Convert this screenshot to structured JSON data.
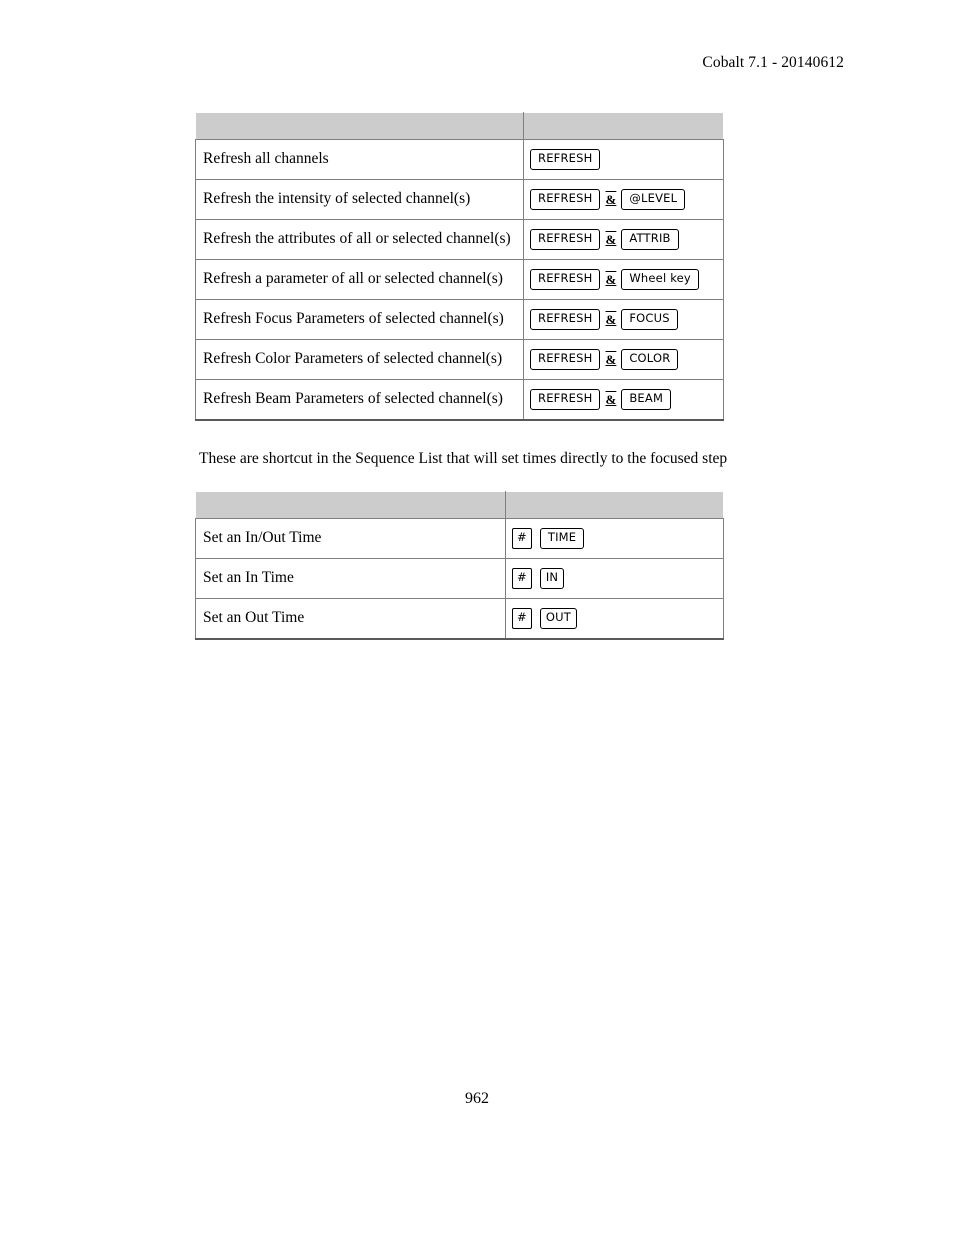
{
  "document": {
    "header": "Cobalt 7.1 - 20140612",
    "page_number": "962"
  },
  "refresh_table": {
    "header": {
      "col1": "",
      "col2": ""
    },
    "rows": [
      {
        "description": "Refresh all channels",
        "keys": [
          {
            "type": "key",
            "label": "REFRESH"
          }
        ]
      },
      {
        "description": "Refresh the intensity of selected channel(s)",
        "keys": [
          {
            "type": "key",
            "label": "REFRESH"
          },
          {
            "type": "sep",
            "label": "&"
          },
          {
            "type": "key",
            "label": "@LEVEL"
          }
        ]
      },
      {
        "description": "Refresh the attributes of all or selected channel(s)",
        "keys": [
          {
            "type": "key",
            "label": "REFRESH"
          },
          {
            "type": "sep",
            "label": "&"
          },
          {
            "type": "key",
            "label": "ATTRIB"
          }
        ]
      },
      {
        "description": "Refresh a parameter of all or selected channel(s)",
        "keys": [
          {
            "type": "key",
            "label": "REFRESH"
          },
          {
            "type": "sep",
            "label": "&"
          },
          {
            "type": "key",
            "label": "Wheel key"
          }
        ]
      },
      {
        "description": "Refresh Focus Parameters of selected channel(s)",
        "keys": [
          {
            "type": "key",
            "label": "REFRESH"
          },
          {
            "type": "sep",
            "label": "&"
          },
          {
            "type": "key",
            "label": "FOCUS"
          }
        ]
      },
      {
        "description": "Refresh Color Parameters of selected channel(s)",
        "keys": [
          {
            "type": "key",
            "label": "REFRESH"
          },
          {
            "type": "sep",
            "label": "&"
          },
          {
            "type": "key",
            "label": "COLOR"
          }
        ]
      },
      {
        "description": "Refresh Beam Parameters of selected channel(s)",
        "keys": [
          {
            "type": "key",
            "label": "REFRESH"
          },
          {
            "type": "sep",
            "label": "&"
          },
          {
            "type": "key",
            "label": "BEAM"
          }
        ]
      }
    ]
  },
  "sequence_note": "These are shortcut in the Sequence List that will set times directly to the focused step",
  "times_table": {
    "header": {
      "col1": "",
      "col2": ""
    },
    "rows": [
      {
        "description": "Set an In/Out Time",
        "keys": [
          {
            "type": "hash",
            "label": "#"
          },
          {
            "type": "key",
            "label": "TIME"
          }
        ]
      },
      {
        "description": "Set an In Time",
        "keys": [
          {
            "type": "hash",
            "label": "#"
          },
          {
            "type": "key",
            "label": "IN"
          }
        ]
      },
      {
        "description": "Set an Out Time",
        "keys": [
          {
            "type": "hash",
            "label": "#"
          },
          {
            "type": "key",
            "label": "OUT"
          }
        ]
      }
    ]
  },
  "colors": {
    "table_header_bg": "#cccccc",
    "table_border": "#808080",
    "text": "#000000",
    "page_bg": "#ffffff"
  }
}
